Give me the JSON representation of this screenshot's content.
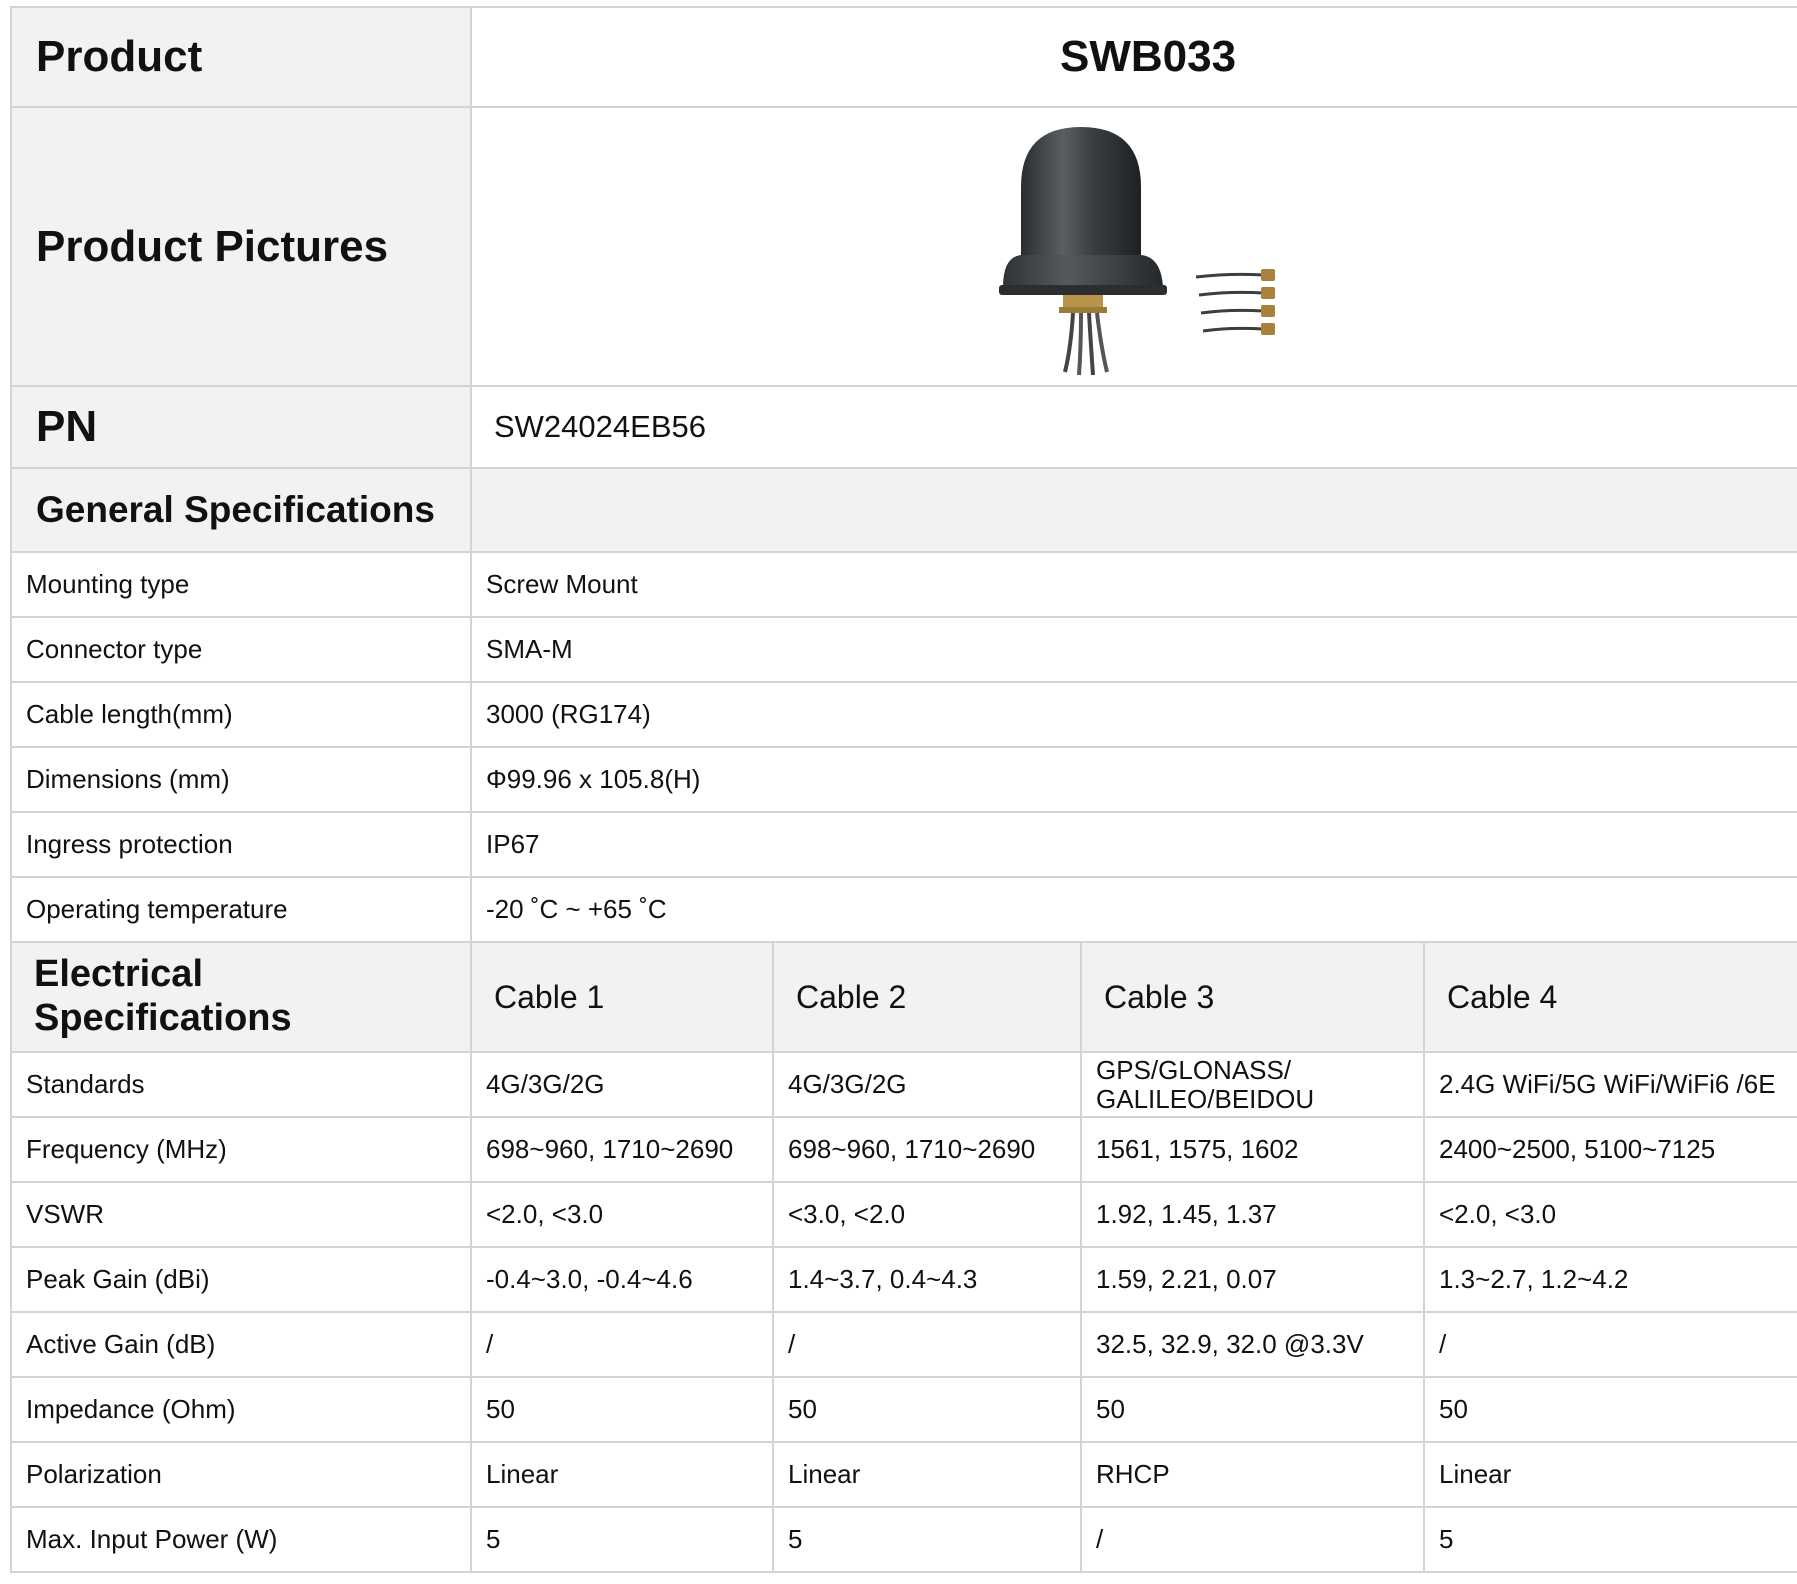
{
  "product": {
    "label": "Product",
    "value": "SWB033"
  },
  "pictures": {
    "label": "Product Pictures"
  },
  "pn": {
    "label": "PN",
    "value": "SW24024EB56"
  },
  "general": {
    "title": "General Specifications",
    "rows": [
      {
        "label": "Mounting type",
        "value": "Screw Mount"
      },
      {
        "label": "Connector type",
        "value": "SMA-M"
      },
      {
        "label": "Cable length(mm)",
        "value": "3000 (RG174)"
      },
      {
        "label": "Dimensions (mm)",
        "value": "Φ99.96 x 105.8(H)"
      },
      {
        "label": "Ingress protection",
        "value": "IP67"
      },
      {
        "label": "Operating temperature",
        "value": "-20 ˚C ~ +65 ˚C"
      }
    ]
  },
  "electrical": {
    "title_line1": "Electrical",
    "title_line2": "Specifications",
    "cables": [
      "Cable 1",
      "Cable 2",
      "Cable 3",
      "Cable 4"
    ],
    "rows": [
      {
        "label": "Standards",
        "values": [
          "4G/3G/2G",
          "4G/3G/2G",
          "GPS/GLONASS/ GALILEO/BEIDOU",
          "2.4G WiFi/5G WiFi/WiFi6 /6E"
        ]
      },
      {
        "label": "Frequency (MHz)",
        "values": [
          "698~960,  1710~2690",
          "698~960,  1710~2690",
          "1561, 1575, 1602",
          "2400~2500,   5100~7125"
        ]
      },
      {
        "label": "VSWR",
        "values": [
          "<2.0,   <3.0",
          "<3.0,   <2.0",
          "1.92,   1.45,    1.37",
          "<2.0,    <3.0"
        ]
      },
      {
        "label": "Peak Gain (dBi)",
        "values": [
          "-0.4~3.0,  -0.4~4.6",
          "1.4~3.7,  0.4~4.3",
          "1.59,    2.21,   0.07",
          "1.3~2.7,   1.2~4.2"
        ]
      },
      {
        "label": "Active Gain (dB)",
        "values": [
          "/",
          "/",
          "32.5,  32.9,  32.0 @3.3V",
          "/"
        ]
      },
      {
        "label": "Impedance (Ohm)",
        "values": [
          "50",
          "50",
          "50",
          "50"
        ]
      },
      {
        "label": "Polarization",
        "values": [
          "Linear",
          "Linear",
          "RHCP",
          "Linear"
        ]
      },
      {
        "label": "Max. Input Power (W)",
        "values": [
          "5",
          "5",
          "/",
          "5"
        ]
      }
    ]
  }
}
